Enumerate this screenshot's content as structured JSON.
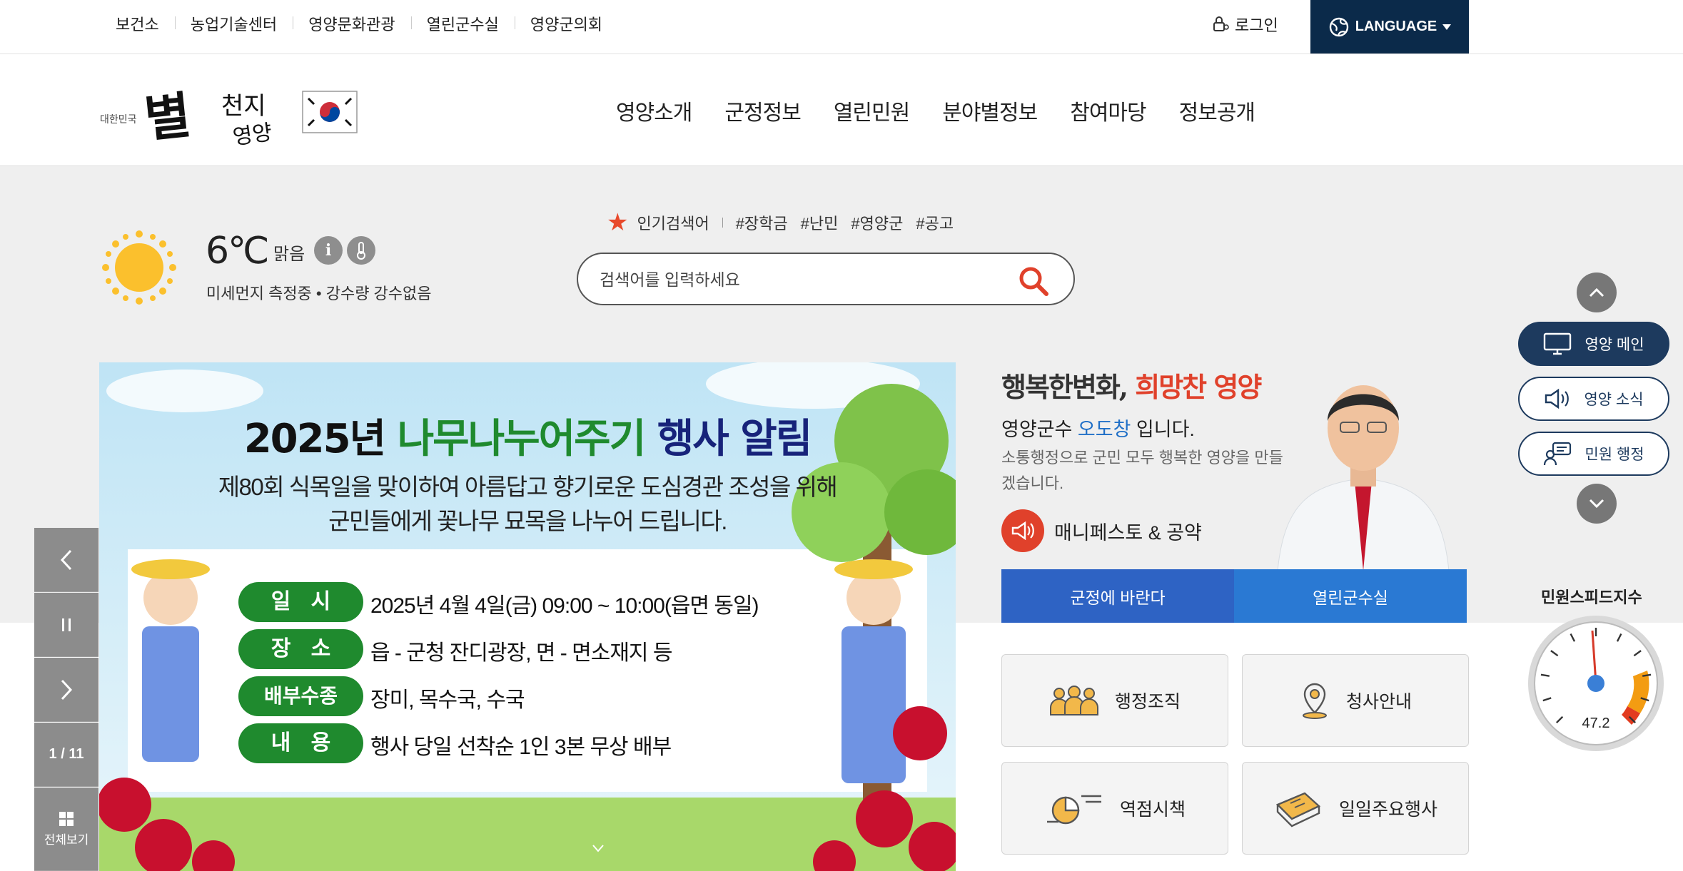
{
  "top_links": [
    "보건소",
    "농업기술센터",
    "영양문화관광",
    "열린군수실",
    "영양군의회"
  ],
  "login": "로그인",
  "language": "LANGUAGE",
  "logo": {
    "small": "대한민국",
    "main": "별천지 영양"
  },
  "gnb": [
    "영양소개",
    "군정정보",
    "열린민원",
    "분야별정보",
    "참여마당",
    "정보공개"
  ],
  "weather": {
    "temp": "6℃",
    "sky": "맑음",
    "info_icon": "i",
    "thermo_icon": "thermometer-icon",
    "detail": "미세먼지 측정중 • 강수량 강수없음"
  },
  "popular": {
    "label": "인기검색어",
    "keywords": [
      "#장학금",
      "#난민",
      "#영양군",
      "#공고"
    ]
  },
  "search": {
    "placeholder": "검색어를 입력하세요"
  },
  "slide": {
    "year": "2025년 ",
    "title_green": "나무나누어주기 ",
    "title_navy": "행사 알림",
    "line1": "제80회 식목일을 맞이하여 아름답고 향기로운 도심경관 조성을 위해",
    "line2": "군민들에게 꽃나무 묘목을 나누어 드립니다.",
    "rows": [
      {
        "label": "일 시",
        "value": "2025년 4월 4일(금) 09:00 ~ 10:00(읍면 동일)"
      },
      {
        "label": "장 소",
        "value": "읍 - 군청 잔디광장, 면 - 면소재지 등"
      },
      {
        "label": "배부수종",
        "value": "장미, 목수국, 수국"
      },
      {
        "label": "내 용",
        "value": "행사 당일 선착순 1인 3본 무상 배부"
      }
    ]
  },
  "slider_ctrl": {
    "count": "1 / 11",
    "all": "전체보기"
  },
  "mayor": {
    "slogan_a": "행복한변화, ",
    "slogan_b": "희망찬 영양",
    "line_pre": "영양군수 ",
    "line_name": "오도창",
    "line_post": " 입니다.",
    "desc": "소통행정으로 군민 모두 행복한 영양을 만들겠습니다.",
    "manifesto": "매니페스토 & 공약",
    "btn1": "군정에 바란다",
    "btn2": "열린군수실"
  },
  "quick": [
    "행정조직",
    "청사안내",
    "역점시책",
    "일일주요행사"
  ],
  "side": [
    "영양 메인",
    "영양 소식",
    "민원 행정"
  ],
  "speed": {
    "title": "민원스피드지수",
    "value": "47.2"
  },
  "colors": {
    "navy": "#0b2a4a",
    "blue": "#2e63c4",
    "red": "#e0412b",
    "green": "#1f8a2e"
  }
}
